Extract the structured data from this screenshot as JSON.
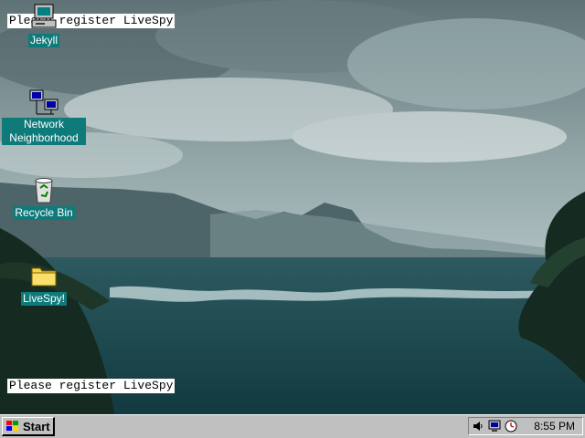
{
  "desktop": {
    "icons": [
      {
        "label": "Jekyll",
        "icon": "computer-icon"
      },
      {
        "label": "Network Neighborhood",
        "icon": "network-neighborhood-icon"
      },
      {
        "label": "Recycle Bin",
        "icon": "recycle-bin-icon"
      },
      {
        "label": "LiveSpy!",
        "icon": "folder-icon"
      }
    ],
    "banner_top": "Please register LiveSpy",
    "banner_bottom": "Please register LiveSpy"
  },
  "taskbar": {
    "start_label": "Start",
    "tray_icons": [
      "speaker-icon",
      "display-icon",
      "clock-app-icon"
    ],
    "clock": "8:55 PM"
  },
  "colors": {
    "icon_label_bg": "#0f7a7a",
    "taskbar": "#c0c0c0"
  }
}
